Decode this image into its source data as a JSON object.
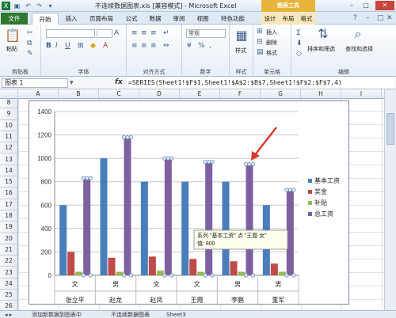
{
  "window": {
    "title": "不连续数据图表.xls [兼容模式] - Microsoft Excel",
    "context_group": "图表工具"
  },
  "ribbon": {
    "tabs": [
      "文件",
      "开始",
      "插入",
      "页面布局",
      "公式",
      "数据",
      "审阅",
      "视图",
      "特色功能",
      "设计",
      "布局",
      "格式"
    ],
    "groups": {
      "clipboard": {
        "label": "剪贴板",
        "paste": "粘贴"
      },
      "font": {
        "label": "字体"
      },
      "alignment": {
        "label": "对齐方式"
      },
      "number": {
        "label": "数字",
        "format": "常规"
      },
      "styles": {
        "label": "样式",
        "btn": "样式"
      },
      "cells": {
        "label": "单元格",
        "insert": "插入",
        "delete": "删除",
        "format": "格式"
      },
      "editing": {
        "label": "编辑",
        "sort": "排序和筛选",
        "find": "查找和选择"
      }
    }
  },
  "formula_bar": {
    "name_box": "图表 1",
    "fx": "fx",
    "formula": "=SERIES(Sheet1!$F$1,Sheet1!$A$2:$B$7,Sheet1!$F$2:$F$7,4)"
  },
  "sheet": {
    "columns": [
      "A",
      "B",
      "C",
      "D",
      "E",
      "F",
      "G",
      "H",
      "I"
    ],
    "rows": [
      "8",
      "9",
      "10",
      "11",
      "12",
      "13",
      "14",
      "15",
      "16",
      "17",
      "18",
      "19",
      "20",
      "21",
      "22",
      "23",
      "24",
      "25",
      "26"
    ]
  },
  "chart_data": {
    "type": "bar",
    "categories": [
      [
        "文",
        "张立平"
      ],
      [
        "男",
        "赵龙"
      ],
      [
        "文",
        "赵凤"
      ],
      [
        "文",
        "王霞"
      ],
      [
        "男",
        "李鹏"
      ],
      [
        "男",
        "董军"
      ]
    ],
    "series": [
      {
        "name": "基本工资",
        "color": "#4a7ebb",
        "values": [
          600,
          1000,
          800,
          800,
          800,
          600
        ]
      },
      {
        "name": "奖金",
        "color": "#be4b48",
        "values": [
          200,
          150,
          160,
          140,
          120,
          100
        ]
      },
      {
        "name": "补贴",
        "color": "#98b954",
        "values": [
          30,
          30,
          40,
          30,
          30,
          30
        ]
      },
      {
        "name": "总工资",
        "color": "#7d60a0",
        "values": [
          830,
          1180,
          1000,
          970,
          950,
          730
        ]
      }
    ],
    "ylim": [
      0,
      1400
    ],
    "yticks": [
      0,
      200,
      400,
      600,
      800,
      1000,
      1200,
      1400
    ],
    "selected_series": "总工资",
    "tooltip": {
      "line1": "系列 \"基本工资\" 点 \"王霞 女\"",
      "line2": "值: 800"
    },
    "legend_position": "right",
    "grid": true
  },
  "sheet_tabs": [
    "添加新数据到图表中",
    "不连续数据图表",
    "Sheet3"
  ]
}
